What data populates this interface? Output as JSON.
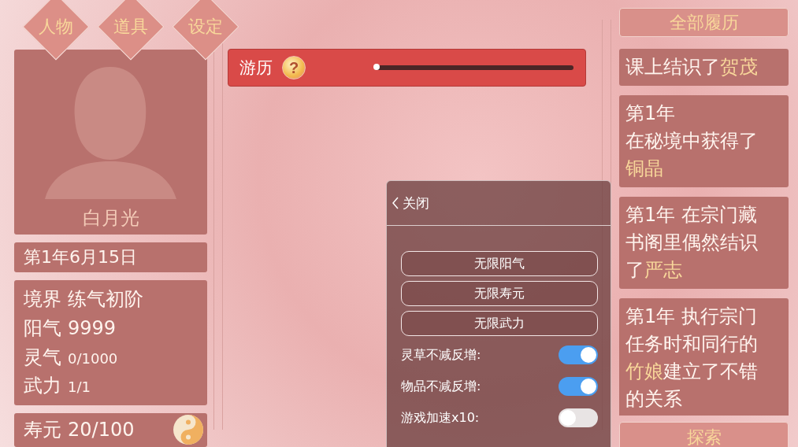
{
  "tabs": [
    {
      "label": "人物",
      "selected": false
    },
    {
      "label": "道具",
      "selected": false
    },
    {
      "label": "设定",
      "selected": false
    }
  ],
  "character": {
    "name": "白月光",
    "date": "第1年6月15日",
    "stats": [
      {
        "kind": "major",
        "label": "境界",
        "value": "练气初阶"
      },
      {
        "kind": "major",
        "label": "阳气",
        "value": "9999"
      },
      {
        "kind": "minor",
        "label": "灵气",
        "value": "0/1000"
      },
      {
        "kind": "minor",
        "label": "武力",
        "value": "1/1"
      }
    ],
    "lifespan": {
      "label": "寿元",
      "value": "20/100"
    }
  },
  "journey": {
    "label": "游历",
    "help": "?",
    "level": 0
  },
  "history": {
    "title": "全部履历",
    "entries": [
      {
        "parts": [
          {
            "text": "课上结识了",
            "highlight": false
          },
          {
            "text": "贺茂",
            "highlight": true
          }
        ]
      },
      {
        "title": "第1年",
        "parts": [
          {
            "text": "在秘境中获得了",
            "highlight": false
          },
          {
            "text": "铜晶",
            "highlight": true
          }
        ]
      },
      {
        "parts": [
          {
            "text": "第1年 在宗门藏书阁里偶然结识了",
            "highlight": false
          },
          {
            "text": "严志",
            "highlight": true
          }
        ]
      },
      {
        "parts": [
          {
            "text": "第1年 执行宗门任务时和同行的",
            "highlight": false
          },
          {
            "text": "竹娘",
            "highlight": true
          },
          {
            "text": "建立了不错的关系",
            "highlight": false
          }
        ]
      }
    ],
    "explore": "探索"
  },
  "cheat_panel": {
    "close": "关闭",
    "buttons": [
      "无限阳气",
      "无限寿元",
      "无限武力"
    ],
    "toggles": [
      {
        "label": "灵草不减反增:",
        "on": true
      },
      {
        "label": "物品不减反增:",
        "on": true
      },
      {
        "label": "游戏加速x10:",
        "on": false
      }
    ]
  }
}
